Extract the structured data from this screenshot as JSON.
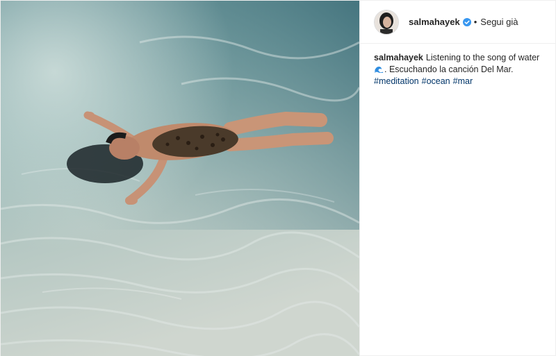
{
  "post": {
    "username": "salmahayek",
    "follow_status": "Segui già",
    "separator": "•",
    "caption_user": "salmahayek",
    "caption_text_1": "Listening to the song of water",
    "caption_text_2": ". Escuchando la canción Del Mar.",
    "hashtags": [
      "#meditation",
      "#ocean",
      "#mar"
    ]
  },
  "icons": {
    "verified": "verified-badge-icon",
    "wave": "water-wave-emoji-icon"
  },
  "colors": {
    "verified_blue": "#3897f0",
    "hashtag": "#003569",
    "text": "#262626",
    "border": "#efefef"
  }
}
